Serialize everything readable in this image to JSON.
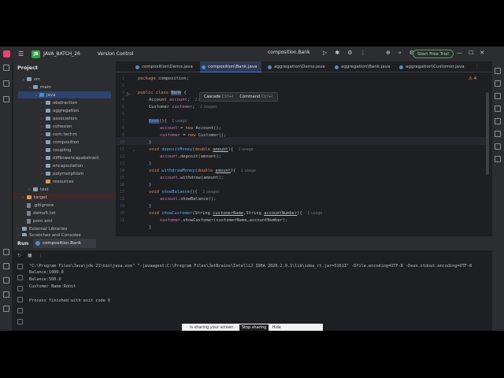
{
  "titlebar": {
    "project_badge": "JB",
    "project_name": "JAVA_BATCH_26",
    "vcs": "Version Control",
    "run_config": "composition.Bank",
    "trial_button": "Start Free Trial"
  },
  "project_panel": {
    "title": "Project",
    "items": [
      {
        "label": "src",
        "level": 1
      },
      {
        "label": "main",
        "level": 2
      },
      {
        "label": "java",
        "level": 3
      },
      {
        "label": "abstraction",
        "level": 4
      },
      {
        "label": "aggregation",
        "level": 4
      },
      {
        "label": "association",
        "level": 4
      },
      {
        "label": "cohesion",
        "level": 4
      },
      {
        "label": "com.techm",
        "level": 4
      },
      {
        "label": "composition",
        "level": 4
      },
      {
        "label": "coupling",
        "level": 4
      },
      {
        "label": "diffbtwencapabstract",
        "level": 4
      },
      {
        "label": "encapsulation",
        "level": 4
      },
      {
        "label": "polymorphism",
        "level": 4
      },
      {
        "label": "resources",
        "level": 3
      },
      {
        "label": "test",
        "level": 2
      },
      {
        "label": "target",
        "level": 1
      },
      {
        "label": ".gitignore",
        "level": 1
      },
      {
        "label": "demo5.txt",
        "level": 1
      },
      {
        "label": "pom.xml",
        "level": 1
      },
      {
        "label": "External Libraries",
        "level": 0
      },
      {
        "label": "Scratches and Consoles",
        "level": 0
      }
    ]
  },
  "tabs": [
    {
      "label": "composition\\Demo.java"
    },
    {
      "label": "composition\\Bank.java"
    },
    {
      "label": "aggregation\\Demo.java"
    },
    {
      "label": "aggregation\\Bank.java"
    },
    {
      "label": "aggregation\\Customer.java"
    }
  ],
  "editor": {
    "status": "⚠ 4",
    "line_numbers": [
      "1",
      "2",
      "3",
      "4",
      "5",
      "6",
      "7",
      "8",
      "9",
      "10",
      "11",
      "12",
      "13",
      "14",
      "15",
      "16",
      "17",
      "18",
      "19",
      "20",
      "21"
    ],
    "lines": {
      "l1_kw": "package",
      "l1_rest": " composition;",
      "l3_kw": "public class",
      "l3_name": "Bank",
      "l3_rest": " {",
      "l4_type": "Account",
      "l4_field": "account",
      "l4_rest": ";",
      "l4_hint": "2 usages",
      "l5_type": "Customer",
      "l5_field": "customer",
      "l5_rest": ";",
      "l5_hint": "2 usages",
      "l7_name": "Bank",
      "l7_rest": "(){",
      "l7_hint": "1 usage",
      "l8_field": "account",
      "l8_eq": " = ",
      "l8_kw": "new",
      "l8_rest": " Account();",
      "l9_field": "customer",
      "l9_eq": " = ",
      "l9_kw": "new",
      "l9_rest": " Customer();",
      "l10": "}",
      "l11_kw": "void",
      "l11_fn": "depositMoney",
      "l11_p1": "(",
      "l11_kw2": "double",
      "l11_param": "amount",
      "l11_rest": "){",
      "l11_hint": "1 usage",
      "l12_field": "account",
      "l12_rest": ".deposit(amount);",
      "l13": "}",
      "l14_kw": "void",
      "l14_fn": "withdrawMoney",
      "l14_p1": "(",
      "l14_kw2": "double",
      "l14_param": "amount",
      "l14_rest": "){",
      "l14_hint": "1 usage",
      "l15_field": "account",
      "l15_rest": ".withdraw(amount);",
      "l16": "}",
      "l17_kw": "void",
      "l17_fn": "showBalance",
      "l17_rest": "(){",
      "l17_hint": "2 usages",
      "l18_field": "account",
      "l18_rest": ".showBalance();",
      "l19": "}",
      "l20_kw": "void",
      "l20_fn": "showCustomer",
      "l20_p1": "(String ",
      "l20_param": "customerName",
      "l20_p2": ",String ",
      "l20_param2": "accountNumber",
      "l20_rest": "){",
      "l20_hint": "1 usage",
      "l21_field": "customer",
      "l21_rest": ".showCustomer(customerName,accountNumber);",
      "l22": "}"
    },
    "popup": {
      "cascade": "Cascade",
      "cascade_key": "Ctrl+I",
      "command": "Command",
      "command_key": "Ctrl+I"
    }
  },
  "run_panel": {
    "title": "Run",
    "tab": "composition.Bank",
    "console": [
      "\"C:\\Program Files\\Java\\jdk-21\\bin\\java.exe\" \"-javaagent:C:\\Program Files\\JetBrains\\IntelliJ IDEA 2026.2.0.1\\lib\\idea_rt.jar=51613\" -Dfile.encoding=UTF-8 -Dsun.stdout.encoding=UTF-8",
      "Balance:1000.0",
      "Balance:500.0",
      "Customer Name:Rohit",
      "",
      "Process finished with exit code 0"
    ]
  },
  "share_bar": {
    "text": "is sharing your screen.",
    "stop": "Stop sharing",
    "hide": "Hide"
  }
}
